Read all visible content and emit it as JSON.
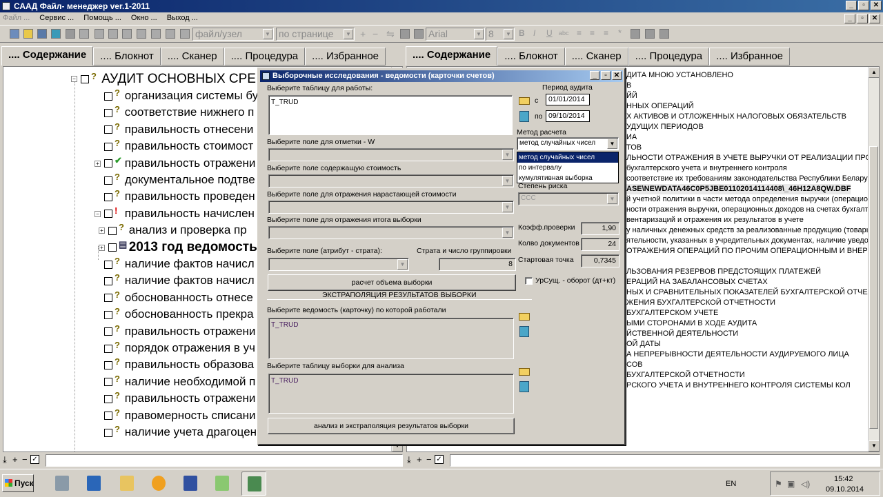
{
  "window": {
    "title": "САAД Файл- менеджер ver.1-2011"
  },
  "menu": [
    "Файл ...",
    "Сервис ...",
    "Помощь ...",
    "Окно ...",
    "Выход ..."
  ],
  "toolbar": {
    "field_select": "файл/узел",
    "page_select": "по странице",
    "font": "Arial",
    "font_size": "8"
  },
  "left_tabs": [
    ".... Содержание",
    ".... Блокнот",
    ".... Сканер",
    ".... Процедура",
    ".... Избранное"
  ],
  "right_tabs": [
    ".... Содержание",
    ".... Блокнот",
    ".... Сканер",
    ".... Процедура",
    ".... Избранное"
  ],
  "tree": {
    "root": "АУДИТ ОСНОВНЫХ СРЕ",
    "items": [
      "организация системы бу",
      "соответствие нижнего п",
      "правильность отнесени",
      "правильность стоимост",
      "правильность отражени",
      "документальное подтве",
      "правильность проведен",
      "правильность начислен",
      "анализ и проверка пр",
      "2013 год ведомость",
      "наличие фактов начисл",
      "наличие фактов начисл",
      "обоснованность отнесе",
      "обоснованность прекра",
      "правильность отражени",
      "порядок отражения в уч",
      "правильность образова",
      "наличие необходимой п",
      "правильность отражени",
      "правомерность списани",
      "наличие учета драгоцен"
    ]
  },
  "report_lines": [
    "ДИТА МНОЮ УСТАНОВЛЕНО",
    "В",
    "ЙЙ",
    "ННЫХ ОПЕРАЦИЙ",
    "Х АКТИВОВ И ОТЛОЖЕННЫХ НАЛОГОВЫХ ОБЯЗАТЕЛЬСТВ",
    "УДУЩИХ ПЕРИОДОВ",
    "ИА",
    "ТОВ",
    "ЛЬНОСТИ ОТРАЖЕНИЯ В УЧЕТЕ ВЫРУЧКИ ОТ РЕАЛИЗАЦИИ ПРОДУКЦ",
    "бухгалтерского учета и внутреннего контроля",
    "соответствие их требованиям законодательства Республики Беларусь",
    "ASE\\NEWDATA46C0P5JBE01102014114408\\_46H12A8QW.DBF",
    "й учетной политики в части метода определения выручки (операционны",
    "ности отражения выручки, операционных доходов на счетах бухгалтерс",
    "вентаризаций и отражения их результатов в учете",
    "у наличных денежных средств за реализованные продукцию (товары, ра",
    "ятельности, указанных в учредительных документах, наличие уведом",
    "ОТРАЖЕНИЯ ОПЕРАЦИЙ ПО ПРОЧИМ ОПЕРАЦИОННЫМ И ВНЕРЕАЛИЗА",
    "",
    "ЛЬЗОВАНИЯ РЕЗЕРВОВ ПРЕДСТОЯЩИХ ПЛАТЕЖЕЙ",
    "ЕРАЦИЙ НА ЗАБАЛАНСОВЫХ СЧЕТАХ",
    "НЫХ И СРАВНИТЕЛЬНЫХ ПОКАЗАТЕЛЕЙ БУХГАЛТЕРСКОЙ ОТЧЕТНОСТИ",
    "ЖЕНИЯ БУХГАЛТЕРСКОЙ ОТЧЕТНОСТИ",
    "БУХГАЛТЕРСКОМ УЧЕТЕ",
    "ЫМИ СТОРОНАМИ В ХОДЕ АУДИТА",
    "ЙСТВЕННОЙ ДЕЯТЕЛЬНОСТИ",
    "ОЙ ДАТЫ",
    "А НЕПРЕРЫВНОСТИ ДЕЯТЕЛЬНОСТИ АУДИРУЕМОГО ЛИЦА",
    "СОВ",
    "БУХГАЛТЕРСКОЙ ОТЧЕТНОСТИ",
    "РСКОГО УЧЕТА И ВНУТРЕННЕГО КОНТРОЛЯ СИСТЕМЫ КОЛ"
  ],
  "dialog": {
    "title": "Выборочные исследования - ведомости (карточки счетов)",
    "select_table_label": "Выберите таблицу  для работы:",
    "select_table_value": "T_TRUD",
    "period_label": "Период аудита",
    "from_label": "с",
    "from_date": "01/01/2014",
    "to_label": "по",
    "to_date": "09/10/2014",
    "method_label": "Метод расчета",
    "method_value": "метод случайных чисел",
    "method_options": [
      "метод случайных чисел",
      "по интервалу",
      "кумулятивная выборка"
    ],
    "mark_field_label": "Выберите поле для отметки - W",
    "cost_field_label": "Выберите поле содержащую стоимость",
    "cumulative_field_label": "Выберите поле для отражения нарастающей стоимости",
    "total_field_label": "Выберите поле для отражения итога выборки",
    "strata_field_label": "Выберите поле (атрибут - страта):",
    "strata_count_label": "Страта и число группировки",
    "strata_count_value": "8",
    "risk_label": "Степень риска",
    "risk_value": "ССС",
    "coef_label": "Коэфф.проверки",
    "coef_value": "1,90",
    "docs_label": "Колво документов",
    "docs_value": "24",
    "start_label": "Стартовая точка",
    "start_value": "0,7345",
    "calc_button": "расчет объема выборки",
    "ursush_label": "УрСущ. - оборот (дт+кт)",
    "extrap_header": "ЭКСТРАПОЛЯЦИЯ РЕЗУЛЬТАТОВ ВЫБОРКИ",
    "ledger_label": "Выберите ведомость (карточку) по которой работали",
    "ledger_value": "T_TRUD",
    "sample_label": "Выберите таблицу  выборки для анализа",
    "sample_value": "T_TRUD",
    "analyze_button": "анализ и экстраполяция результатов  выборки"
  },
  "taskbar": {
    "start": "Пуск",
    "lang": "EN",
    "time": "15:42",
    "date": "09.10.2014"
  }
}
